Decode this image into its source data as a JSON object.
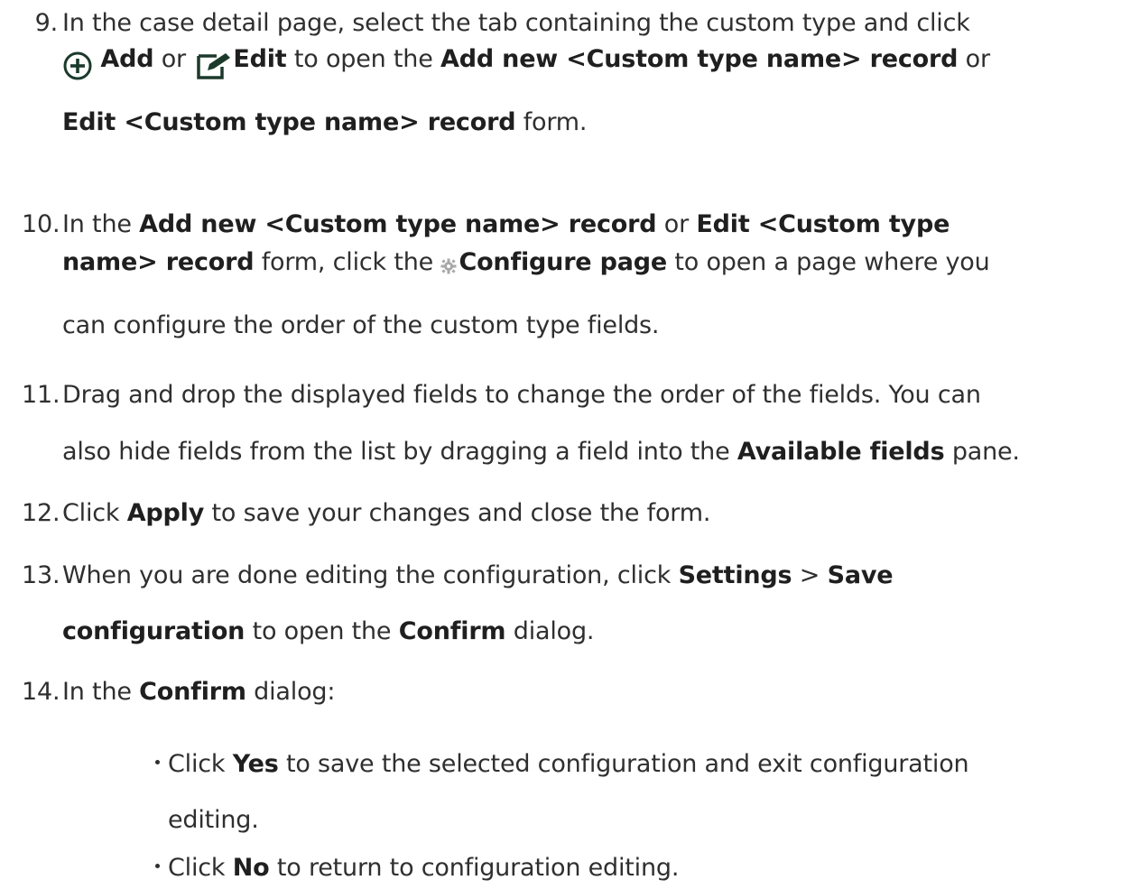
{
  "steps": [
    {
      "number": "9.",
      "text": {
        "p1": "In the case detail page, select the tab containing the custom type and click",
        "b_add": "Add",
        "or1": " or ",
        "b_edit": "Edit",
        "to_open": " to open the ",
        "b_add_new": "Add new <Custom type name> record",
        "or2": " or",
        "b_edit_rec": "Edit <Custom type name> record",
        "form": " form."
      }
    },
    {
      "number": "10.",
      "text": {
        "in_the": "In the ",
        "b_add_new": "Add new <Custom type name> record",
        "or": " or ",
        "b_edit_custom": "Edit <Custom type",
        "b_name_rec": "name> record",
        "form_click": " form, click the ",
        "b_configure": "Configure page",
        "to_open": " to open a page where you",
        "p3": "can configure the order of the custom type fields."
      }
    },
    {
      "number": "11.",
      "text": {
        "p1": "Drag and drop the displayed fields to change the order of the fields. You can",
        "p2a": "also hide fields from the list by dragging a field into the ",
        "b_available": "Available fields",
        "p2b": " pane."
      }
    },
    {
      "number": "12.",
      "text": {
        "click": "Click ",
        "b_apply": "Apply",
        "rest": " to save your changes and close the form."
      }
    },
    {
      "number": "13.",
      "text": {
        "p1": "When you are done editing the configuration, click ",
        "b_settings": "Settings",
        "gt": " > ",
        "b_save": "Save",
        "b_configuration": "configuration",
        "to_open": " to open the ",
        "b_confirm": "Confirm",
        "dialog": " dialog."
      }
    },
    {
      "number": "14.",
      "text": {
        "in_the": "In the ",
        "b_confirm": "Confirm",
        "dialog": " dialog:"
      },
      "bullets": [
        {
          "click": "Click ",
          "b": "Yes",
          "rest1": " to save the selected configuration and exit configuration",
          "rest2": "editing."
        },
        {
          "click": "Click ",
          "b": "No",
          "rest1": " to return to configuration editing."
        }
      ]
    }
  ],
  "icons": {
    "add": "add-circle-icon",
    "edit": "edit-pencil-icon",
    "configure": "gear-icon"
  }
}
